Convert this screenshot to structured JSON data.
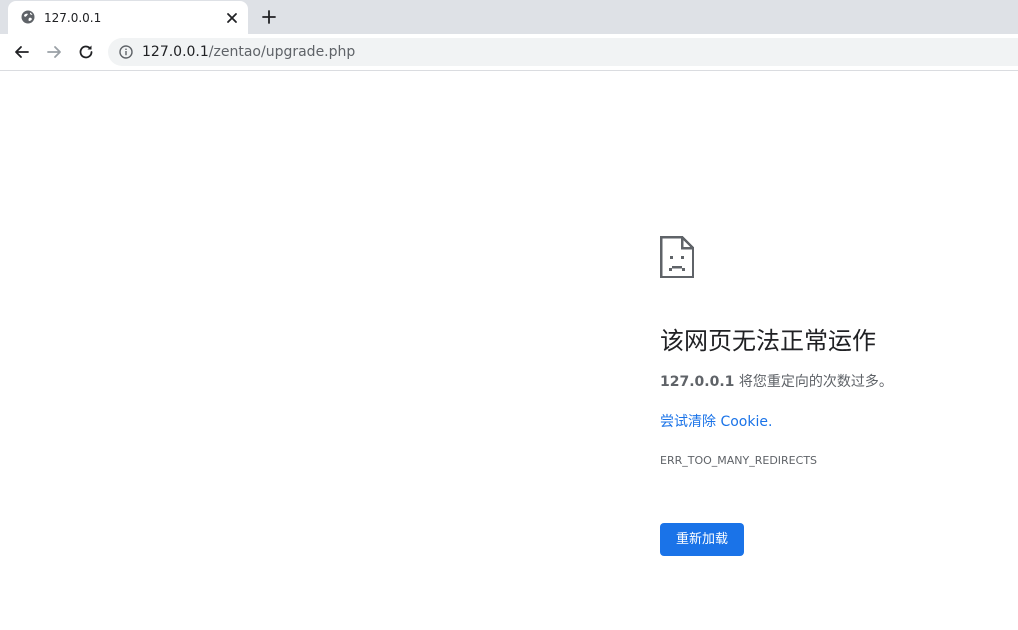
{
  "browser": {
    "tab": {
      "title": "127.0.0.1",
      "favicon": "globe-icon"
    },
    "address": {
      "host": "127.0.0.1",
      "path": "/zentao/upgrade.php"
    },
    "icons": {
      "back": "arrow-left-icon",
      "forward": "arrow-right-icon",
      "reload": "reload-icon",
      "site_info": "info-icon",
      "close_tab": "close-icon",
      "new_tab": "plus-icon"
    }
  },
  "error_page": {
    "icon": "sad-document-icon",
    "heading": "该网页无法正常运作",
    "host": "127.0.0.1",
    "message": " 将您重定向的次数过多。",
    "clear_cookies_link": "尝试清除 Cookie.",
    "error_code": "ERR_TOO_MANY_REDIRECTS",
    "reload_button": "重新加载"
  },
  "colors": {
    "accent": "#1a73e8",
    "tabstrip": "#dee1e6",
    "omnibox": "#f1f3f4",
    "heading_text": "#202124",
    "secondary_text": "#5f6368"
  }
}
